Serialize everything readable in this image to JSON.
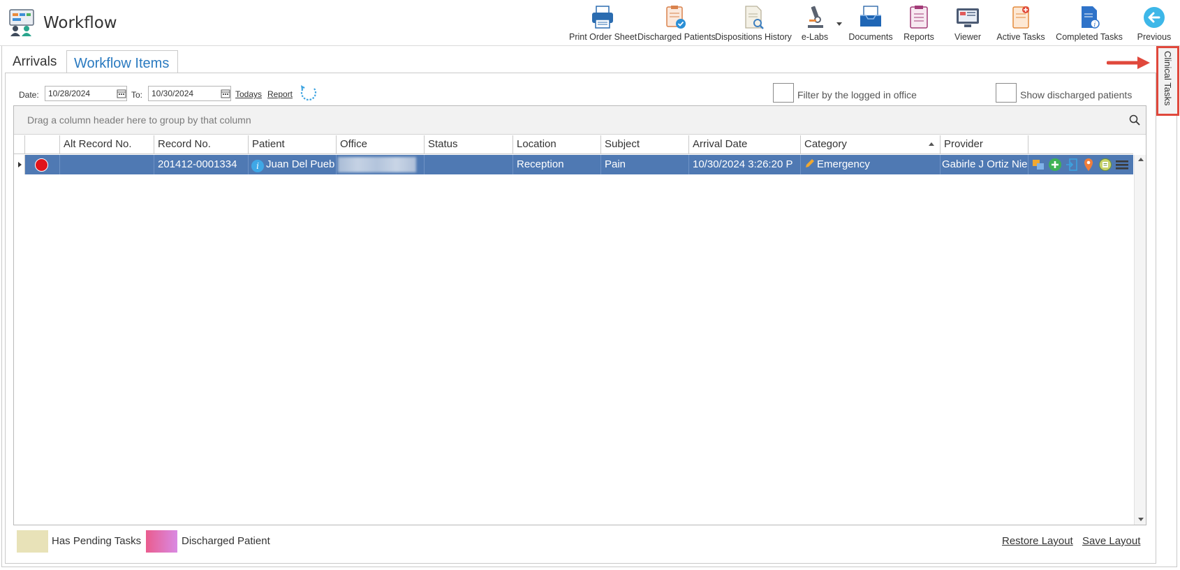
{
  "app": {
    "title": "Workflow"
  },
  "toolbar": {
    "items": [
      {
        "label": "Print Order Sheet",
        "icon": "printer-icon"
      },
      {
        "label": "Discharged Patients",
        "icon": "discharged-patients-icon"
      },
      {
        "label": "Dispositions History",
        "icon": "dispositions-history-icon"
      },
      {
        "label": "e-Labs",
        "icon": "microscope-icon"
      },
      {
        "label": "Documents",
        "icon": "documents-tray-icon"
      },
      {
        "label": "Reports",
        "icon": "reports-icon"
      },
      {
        "label": "Viewer",
        "icon": "viewer-monitor-icon"
      },
      {
        "label": "Active Tasks",
        "icon": "active-tasks-icon"
      },
      {
        "label": "Completed Tasks",
        "icon": "completed-tasks-icon"
      },
      {
        "label": "Previous",
        "icon": "back-arrow-icon"
      }
    ]
  },
  "tabs": {
    "arrivals": "Arrivals",
    "workflow_items": "Workflow Items"
  },
  "filters": {
    "date_label": "Date:",
    "date_from": "10/28/2024",
    "to_label": "To:",
    "date_to": "10/30/2024",
    "todays_link": "Todays",
    "report_link": "Report",
    "filter_office_label": "Filter by the logged in office",
    "filter_office_checked": false,
    "show_discharged_label": "Show discharged patients",
    "show_discharged_checked": false
  },
  "grid": {
    "group_panel_text": "Drag a column header here to group by that column",
    "columns": [
      "",
      "Alt Record No.",
      "Record No.",
      "Patient",
      "Office",
      "Status",
      "Location",
      "Subject",
      "Arrival Date",
      "Category",
      "Provider",
      ""
    ],
    "sorted_column": "Category",
    "rows": [
      {
        "status_color": "#e0141b",
        "alt_record_no": "",
        "record_no": "201412-0001334",
        "patient": "Juan Del Pueb",
        "office": "",
        "status": "",
        "location": "Reception",
        "subject": "Pain",
        "arrival_date": "10/30/2024 3:26:20 P",
        "category": "Emergency",
        "provider": "Gabirle J Ortiz Nie"
      }
    ]
  },
  "legend": {
    "pending_label": "Has Pending Tasks",
    "pending_color": "#e8e2b8",
    "discharged_label": "Discharged Patient",
    "discharged_color": "#e66db0"
  },
  "footer": {
    "restore_layout": "Restore Layout",
    "save_layout": "Save Layout"
  },
  "side_panel": {
    "label": "Clinical Tasks"
  },
  "colors": {
    "selected_row": "#4f79b3",
    "accent": "#2a7ac0",
    "highlight_border": "#e0483c"
  }
}
